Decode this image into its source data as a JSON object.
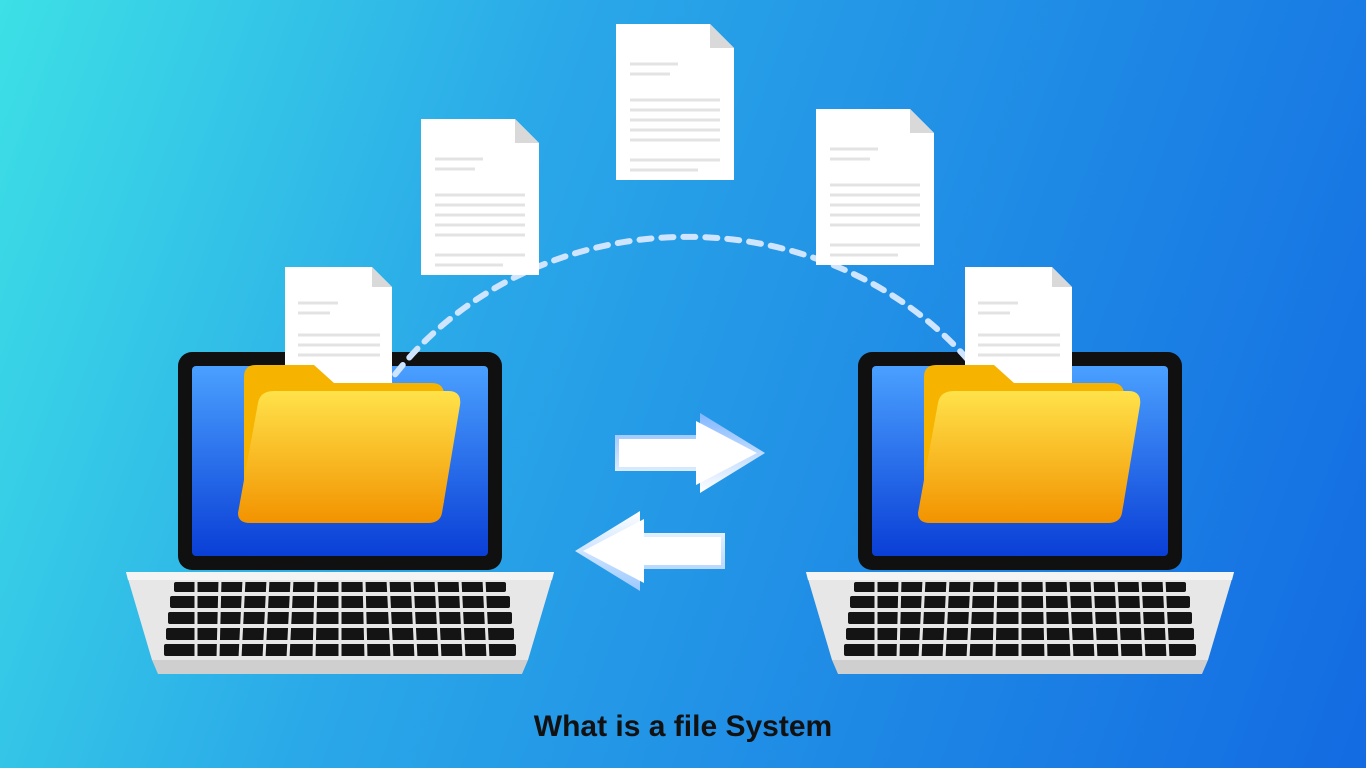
{
  "caption": "What is a file System",
  "colors": {
    "bg_from": "#3de0e6",
    "bg_to": "#136be2",
    "folder_top": "#ffe24a",
    "folder_bottom": "#f29300",
    "doc_fill": "#ffffff",
    "doc_line": "#e3e3e3",
    "doc_corner": "#d9d9d9",
    "screen_top": "#4aa0ff",
    "screen_bottom": "#0a3fd6",
    "laptop_body": "#e7e7e7",
    "keyboard_key": "#141414",
    "arrow_fill": "#ffffff",
    "arrow_edge_top": "#7fb6ff",
    "arrow_edge_bottom": "#9cc9ff",
    "arc_dash": "#cfe4ff"
  },
  "icons": {
    "laptop_left": "laptop-icon",
    "laptop_right": "laptop-icon",
    "folder": "folder-icon",
    "document": "document-icon",
    "arrow_right": "arrow-right-icon",
    "arrow_left": "arrow-left-icon",
    "transfer_arc": "transfer-arc-icon"
  }
}
